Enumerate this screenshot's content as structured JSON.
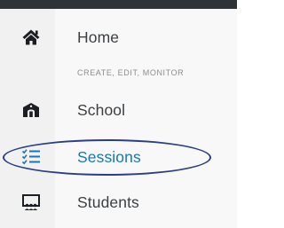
{
  "nav": {
    "home": {
      "label": "Home",
      "icon": "home-icon"
    },
    "section_header": "CREATE, EDIT, MONITOR",
    "school": {
      "label": "School",
      "icon": "school-building-icon"
    },
    "sessions": {
      "label": "Sessions",
      "icon": "checklist-icon",
      "active": true
    },
    "students": {
      "label": "Students",
      "icon": "presentation-board-icon"
    }
  },
  "colors": {
    "text": "#3c3f43",
    "active": "#1a74b8",
    "highlight_ring": "#2a3f86",
    "top_bar": "#2e3338"
  }
}
